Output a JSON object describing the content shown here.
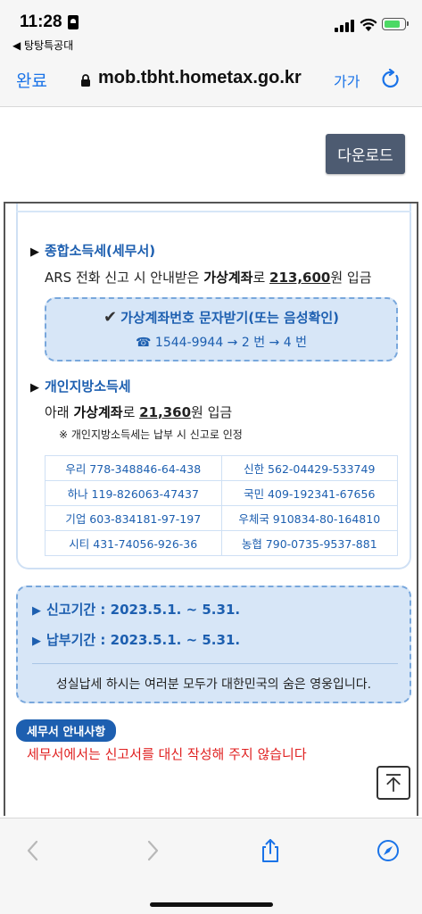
{
  "status_bar": {
    "time": "11:28",
    "back_app": "◀ 탕탕특공대"
  },
  "browser": {
    "done_label": "완료",
    "url": "mob.tbht.hometax.go.kr",
    "text_size_label": "가가"
  },
  "page": {
    "download_label": "다운로드",
    "income_tax": {
      "title": "종합소득세(세무서)",
      "line_prefix": "ARS 전화 신고 시 안내받은 ",
      "line_bold": "가상계좌",
      "line_mid": "로 ",
      "line_amount": "213,600",
      "line_suffix": "원 입금",
      "vbox_title": "가상계좌번호 문자받기(또는 음성확인)",
      "vbox_sub": "☎ 1544-9944 → 2 번 → 4 번"
    },
    "local_tax": {
      "title": "개인지방소득세",
      "line_prefix": "아래 ",
      "line_bold": "가상계좌",
      "line_mid": "로 ",
      "line_amount": "21,360",
      "line_suffix": "원 입금",
      "note": "※ 개인지방소득세는 납부 시 신고로 인정"
    },
    "banks": [
      [
        "우리 778-348846-64-438",
        "신한 562-04429-533749"
      ],
      [
        "하나 119-826063-47437",
        "국민 409-192341-67656"
      ],
      [
        "기업 603-834181-97-197",
        "우체국 910834-80-164810"
      ],
      [
        "시티 431-74056-926-36",
        "농협 790-0735-9537-881"
      ]
    ],
    "periods": {
      "report": "신고기간 : 2023.5.1. ~ 5.31.",
      "payment": "납부기간 : 2023.5.1. ~ 5.31."
    },
    "slogan": "성실납세 하시는 여러분 모두가 대한민국의 숨은 영웅입니다.",
    "notice_badge": "세무서 안내사항",
    "notice_text": "세무서에서는 신고서를 대신 작성해 주지 않습니다"
  },
  "colors": {
    "accent": "#1d5fb0",
    "ios_blue": "#1a73e8",
    "box_bg": "#d7e6f7",
    "warning": "#e02020",
    "download_bg": "#4d5b71"
  },
  "icons": [
    "lock-icon",
    "reload-icon",
    "back-arrow-icon",
    "forward-arrow-icon",
    "share-icon",
    "compass-icon",
    "scroll-top-icon"
  ]
}
